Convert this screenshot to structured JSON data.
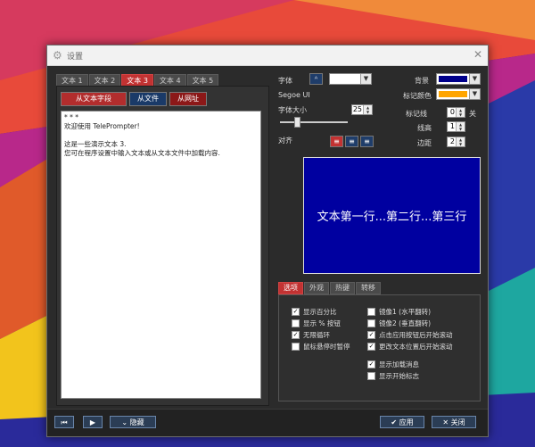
{
  "window": {
    "title": "设置"
  },
  "tabs": [
    "文本 1",
    "文本 2",
    "文本 3",
    "文本 4",
    "文本 5"
  ],
  "active_tab": 2,
  "sources": {
    "from_field": "从文本字段",
    "from_file": "从文件",
    "from_url": "从网址"
  },
  "editor_text": "* * *\n欢迎使用 TelePrompter!\n\n这是一些演示文本 3.\n您可在程序设置中输入文本或从文本文件中加载内容.",
  "font": {
    "label": "字体",
    "name": "Segoe UI",
    "size_label": "字体大小",
    "size": "25",
    "size_fraction": 0.25
  },
  "align": {
    "label": "对齐"
  },
  "colors": {
    "bg_label": "背景",
    "bg": "#00008b",
    "marker_label": "标记颜色",
    "marker": "#ffa500",
    "font": "#ffffff"
  },
  "marker_line": {
    "label": "标记线",
    "value": "0",
    "state": "关"
  },
  "line_height": {
    "label": "线高",
    "value": "1"
  },
  "margin": {
    "label": "边距",
    "value": "2"
  },
  "preview_text": "文本第一行...第二行...第三行",
  "option_tabs": [
    "选项",
    "外观",
    "热键",
    "转移"
  ],
  "options": {
    "col1": [
      {
        "label": "显示百分比",
        "checked": true
      },
      {
        "label": "显示 % 按钮",
        "checked": false
      },
      {
        "label": "无限循环",
        "checked": true
      },
      {
        "label": "鼠标悬停时暂停",
        "checked": false
      }
    ],
    "col2": [
      {
        "label": "镜像1 (水平翻转)",
        "checked": false
      },
      {
        "label": "镜像2 (垂直翻转)",
        "checked": false
      },
      {
        "label": "点击应用按钮后开始滚动",
        "checked": true
      },
      {
        "label": "更改文本位置后开始滚动",
        "checked": true
      }
    ],
    "col2b": [
      {
        "label": "显示加载消息",
        "checked": true
      },
      {
        "label": "显示开始标志",
        "checked": false
      }
    ]
  },
  "bottom": {
    "first_icon": "skip-to-start",
    "play_icon": "play",
    "hide": "隐藏",
    "apply": "应用",
    "close": "关闭"
  },
  "icons": {
    "gear": "gear-icon",
    "close": "close-icon",
    "font": "font-icon"
  }
}
